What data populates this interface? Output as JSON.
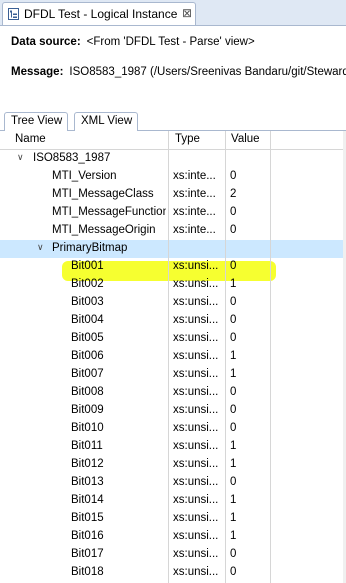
{
  "editor_tab": {
    "title": "DFDL Test - Logical Instance",
    "close": "⊠"
  },
  "data_source": {
    "label": "Data source:",
    "value": "<From 'DFDL Test - Parse' view>"
  },
  "message": {
    "label": "Message:",
    "value": "ISO8583_1987 (/Users/Sreenivas Bandaru/git/Steward"
  },
  "view_tabs": [
    "Tree View",
    "XML View"
  ],
  "columns": {
    "name": "Name",
    "type": "Type",
    "value": "Value"
  },
  "rows": [
    {
      "name": "ISO8583_1987",
      "type": "",
      "value": "",
      "level": 0,
      "expanded": true
    },
    {
      "name": "MTI_Version",
      "type": "xs:inte...",
      "value": "0",
      "level": 2
    },
    {
      "name": "MTI_MessageClass",
      "type": "xs:inte...",
      "value": "2",
      "level": 2
    },
    {
      "name": "MTI_MessageFunction",
      "type": "xs:inte...",
      "value": "0",
      "level": 2
    },
    {
      "name": "MTI_MessageOrigin",
      "type": "xs:inte...",
      "value": "0",
      "level": 2
    },
    {
      "name": "PrimaryBitmap",
      "type": "",
      "value": "",
      "level": 1,
      "expanded": true,
      "selected": true
    },
    {
      "name": "Bit001",
      "type": "xs:unsi...",
      "value": "0",
      "level": 3,
      "highlighted": true
    },
    {
      "name": "Bit002",
      "type": "xs:unsi...",
      "value": "1",
      "level": 3
    },
    {
      "name": "Bit003",
      "type": "xs:unsi...",
      "value": "0",
      "level": 3
    },
    {
      "name": "Bit004",
      "type": "xs:unsi...",
      "value": "0",
      "level": 3
    },
    {
      "name": "Bit005",
      "type": "xs:unsi...",
      "value": "0",
      "level": 3
    },
    {
      "name": "Bit006",
      "type": "xs:unsi...",
      "value": "1",
      "level": 3
    },
    {
      "name": "Bit007",
      "type": "xs:unsi...",
      "value": "1",
      "level": 3
    },
    {
      "name": "Bit008",
      "type": "xs:unsi...",
      "value": "0",
      "level": 3
    },
    {
      "name": "Bit009",
      "type": "xs:unsi...",
      "value": "0",
      "level": 3
    },
    {
      "name": "Bit010",
      "type": "xs:unsi...",
      "value": "0",
      "level": 3
    },
    {
      "name": "Bit011",
      "type": "xs:unsi...",
      "value": "1",
      "level": 3
    },
    {
      "name": "Bit012",
      "type": "xs:unsi...",
      "value": "1",
      "level": 3
    },
    {
      "name": "Bit013",
      "type": "xs:unsi...",
      "value": "0",
      "level": 3
    },
    {
      "name": "Bit014",
      "type": "xs:unsi...",
      "value": "1",
      "level": 3
    },
    {
      "name": "Bit015",
      "type": "xs:unsi...",
      "value": "1",
      "level": 3
    },
    {
      "name": "Bit016",
      "type": "xs:unsi...",
      "value": "1",
      "level": 3
    },
    {
      "name": "Bit017",
      "type": "xs:unsi...",
      "value": "0",
      "level": 3
    },
    {
      "name": "Bit018",
      "type": "xs:unsi...",
      "value": "0",
      "level": 3
    }
  ],
  "colors": {
    "selection": "#cce8ff",
    "highlighter": "#f5ff1e"
  }
}
